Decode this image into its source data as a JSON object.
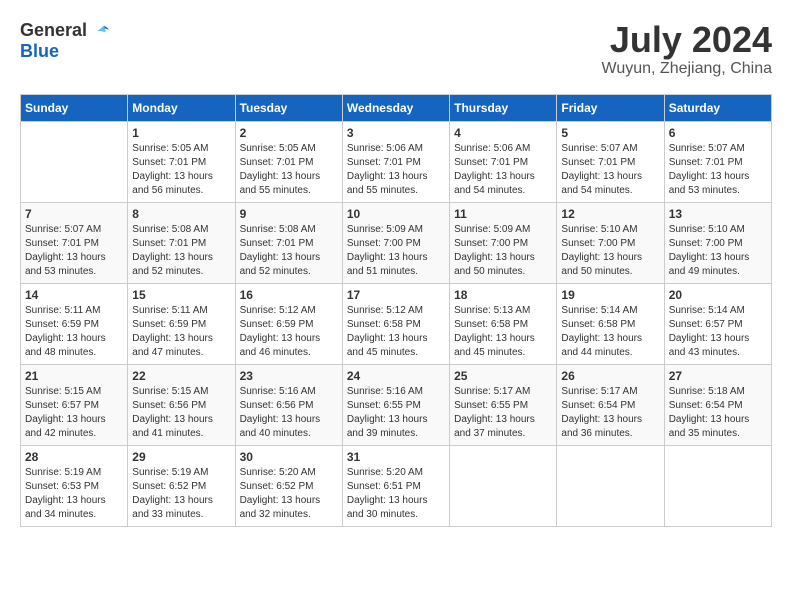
{
  "header": {
    "logo_general": "General",
    "logo_blue": "Blue",
    "month_year": "July 2024",
    "location": "Wuyun, Zhejiang, China"
  },
  "weekdays": [
    "Sunday",
    "Monday",
    "Tuesday",
    "Wednesday",
    "Thursday",
    "Friday",
    "Saturday"
  ],
  "weeks": [
    [
      {
        "day": "",
        "sunrise": "",
        "sunset": "",
        "daylight": ""
      },
      {
        "day": "1",
        "sunrise": "5:05 AM",
        "sunset": "7:01 PM",
        "daylight": "13 hours and 56 minutes."
      },
      {
        "day": "2",
        "sunrise": "5:05 AM",
        "sunset": "7:01 PM",
        "daylight": "13 hours and 55 minutes."
      },
      {
        "day": "3",
        "sunrise": "5:06 AM",
        "sunset": "7:01 PM",
        "daylight": "13 hours and 55 minutes."
      },
      {
        "day": "4",
        "sunrise": "5:06 AM",
        "sunset": "7:01 PM",
        "daylight": "13 hours and 54 minutes."
      },
      {
        "day": "5",
        "sunrise": "5:07 AM",
        "sunset": "7:01 PM",
        "daylight": "13 hours and 54 minutes."
      },
      {
        "day": "6",
        "sunrise": "5:07 AM",
        "sunset": "7:01 PM",
        "daylight": "13 hours and 53 minutes."
      }
    ],
    [
      {
        "day": "7",
        "sunrise": "5:07 AM",
        "sunset": "7:01 PM",
        "daylight": "13 hours and 53 minutes."
      },
      {
        "day": "8",
        "sunrise": "5:08 AM",
        "sunset": "7:01 PM",
        "daylight": "13 hours and 52 minutes."
      },
      {
        "day": "9",
        "sunrise": "5:08 AM",
        "sunset": "7:01 PM",
        "daylight": "13 hours and 52 minutes."
      },
      {
        "day": "10",
        "sunrise": "5:09 AM",
        "sunset": "7:00 PM",
        "daylight": "13 hours and 51 minutes."
      },
      {
        "day": "11",
        "sunrise": "5:09 AM",
        "sunset": "7:00 PM",
        "daylight": "13 hours and 50 minutes."
      },
      {
        "day": "12",
        "sunrise": "5:10 AM",
        "sunset": "7:00 PM",
        "daylight": "13 hours and 50 minutes."
      },
      {
        "day": "13",
        "sunrise": "5:10 AM",
        "sunset": "7:00 PM",
        "daylight": "13 hours and 49 minutes."
      }
    ],
    [
      {
        "day": "14",
        "sunrise": "5:11 AM",
        "sunset": "6:59 PM",
        "daylight": "13 hours and 48 minutes."
      },
      {
        "day": "15",
        "sunrise": "5:11 AM",
        "sunset": "6:59 PM",
        "daylight": "13 hours and 47 minutes."
      },
      {
        "day": "16",
        "sunrise": "5:12 AM",
        "sunset": "6:59 PM",
        "daylight": "13 hours and 46 minutes."
      },
      {
        "day": "17",
        "sunrise": "5:12 AM",
        "sunset": "6:58 PM",
        "daylight": "13 hours and 45 minutes."
      },
      {
        "day": "18",
        "sunrise": "5:13 AM",
        "sunset": "6:58 PM",
        "daylight": "13 hours and 45 minutes."
      },
      {
        "day": "19",
        "sunrise": "5:14 AM",
        "sunset": "6:58 PM",
        "daylight": "13 hours and 44 minutes."
      },
      {
        "day": "20",
        "sunrise": "5:14 AM",
        "sunset": "6:57 PM",
        "daylight": "13 hours and 43 minutes."
      }
    ],
    [
      {
        "day": "21",
        "sunrise": "5:15 AM",
        "sunset": "6:57 PM",
        "daylight": "13 hours and 42 minutes."
      },
      {
        "day": "22",
        "sunrise": "5:15 AM",
        "sunset": "6:56 PM",
        "daylight": "13 hours and 41 minutes."
      },
      {
        "day": "23",
        "sunrise": "5:16 AM",
        "sunset": "6:56 PM",
        "daylight": "13 hours and 40 minutes."
      },
      {
        "day": "24",
        "sunrise": "5:16 AM",
        "sunset": "6:55 PM",
        "daylight": "13 hours and 39 minutes."
      },
      {
        "day": "25",
        "sunrise": "5:17 AM",
        "sunset": "6:55 PM",
        "daylight": "13 hours and 37 minutes."
      },
      {
        "day": "26",
        "sunrise": "5:17 AM",
        "sunset": "6:54 PM",
        "daylight": "13 hours and 36 minutes."
      },
      {
        "day": "27",
        "sunrise": "5:18 AM",
        "sunset": "6:54 PM",
        "daylight": "13 hours and 35 minutes."
      }
    ],
    [
      {
        "day": "28",
        "sunrise": "5:19 AM",
        "sunset": "6:53 PM",
        "daylight": "13 hours and 34 minutes."
      },
      {
        "day": "29",
        "sunrise": "5:19 AM",
        "sunset": "6:52 PM",
        "daylight": "13 hours and 33 minutes."
      },
      {
        "day": "30",
        "sunrise": "5:20 AM",
        "sunset": "6:52 PM",
        "daylight": "13 hours and 32 minutes."
      },
      {
        "day": "31",
        "sunrise": "5:20 AM",
        "sunset": "6:51 PM",
        "daylight": "13 hours and 30 minutes."
      },
      {
        "day": "",
        "sunrise": "",
        "sunset": "",
        "daylight": ""
      },
      {
        "day": "",
        "sunrise": "",
        "sunset": "",
        "daylight": ""
      },
      {
        "day": "",
        "sunrise": "",
        "sunset": "",
        "daylight": ""
      }
    ]
  ]
}
